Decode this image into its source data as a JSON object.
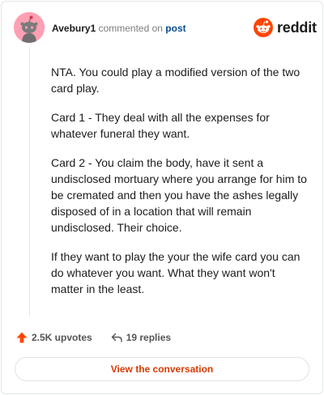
{
  "comment": {
    "username": "Avebury1",
    "action_text": " commented on ",
    "post_link": "post",
    "paragraphs": [
      "NTA. You could play a modified version of the two card play.",
      "Card 1 - They deal with all the expenses for whatever funeral they want.",
      "Card 2 - You claim the body, have it sent a undisclosed mortuary where you arrange for him to be cremated and then you have the ashes legally disposed of in a location that will remain undisclosed. Their choice.",
      "If they want to play the your the wife card you can do whatever you want. What they want won't matter in the least."
    ]
  },
  "brand": {
    "wordmark": "reddit",
    "icon": "reddit-alien-icon",
    "color": "#ff4500"
  },
  "footer": {
    "upvotes": "2.5K upvotes",
    "replies": "19 replies",
    "upvote_icon": "upvote-arrow-icon",
    "reply_icon": "reply-arrow-icon",
    "upvote_color": "#ff4500"
  },
  "cta": {
    "label": "View the conversation",
    "color": "#d93a00"
  },
  "avatar": {
    "icon": "snoo-avatar-icon",
    "background": "#ff9fb3"
  }
}
